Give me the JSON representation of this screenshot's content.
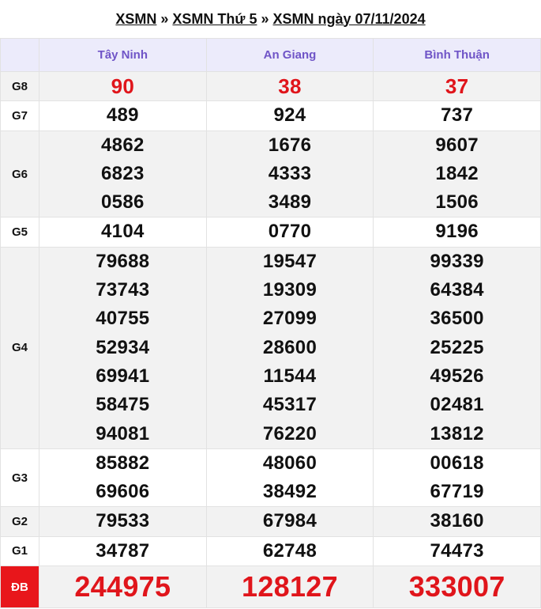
{
  "breadcrumb": {
    "sep": "»",
    "items": [
      "XSMN",
      "XSMN Thứ 5",
      "XSMN ngày 07/11/2024"
    ]
  },
  "provinces": [
    "Tây Ninh",
    "An Giang",
    "Bình Thuận"
  ],
  "prizes": [
    {
      "label": "G8",
      "values": [
        [
          "90"
        ],
        [
          "38"
        ],
        [
          "37"
        ]
      ]
    },
    {
      "label": "G7",
      "values": [
        [
          "489"
        ],
        [
          "924"
        ],
        [
          "737"
        ]
      ]
    },
    {
      "label": "G6",
      "values": [
        [
          "4862",
          "6823",
          "0586"
        ],
        [
          "1676",
          "4333",
          "3489"
        ],
        [
          "9607",
          "1842",
          "1506"
        ]
      ]
    },
    {
      "label": "G5",
      "values": [
        [
          "4104"
        ],
        [
          "0770"
        ],
        [
          "9196"
        ]
      ]
    },
    {
      "label": "G4",
      "values": [
        [
          "79688",
          "73743",
          "40755",
          "52934",
          "69941",
          "58475",
          "94081"
        ],
        [
          "19547",
          "19309",
          "27099",
          "28600",
          "11544",
          "45317",
          "76220"
        ],
        [
          "99339",
          "64384",
          "36500",
          "25225",
          "49526",
          "02481",
          "13812"
        ]
      ]
    },
    {
      "label": "G3",
      "values": [
        [
          "85882",
          "69606"
        ],
        [
          "48060",
          "38492"
        ],
        [
          "00618",
          "67719"
        ]
      ]
    },
    {
      "label": "G2",
      "values": [
        [
          "79533"
        ],
        [
          "67984"
        ],
        [
          "38160"
        ]
      ]
    },
    {
      "label": "G1",
      "values": [
        [
          "34787"
        ],
        [
          "62748"
        ],
        [
          "74473"
        ]
      ]
    },
    {
      "label": "ĐB",
      "values": [
        [
          "244975"
        ],
        [
          "128127"
        ],
        [
          "333007"
        ]
      ]
    }
  ],
  "colors": {
    "header_bg": "#ecebfb",
    "header_text": "#6f54c7",
    "special_red": "#e0151b",
    "db_label_bg": "#e8161b",
    "row_shade": "#f2f2f2"
  }
}
